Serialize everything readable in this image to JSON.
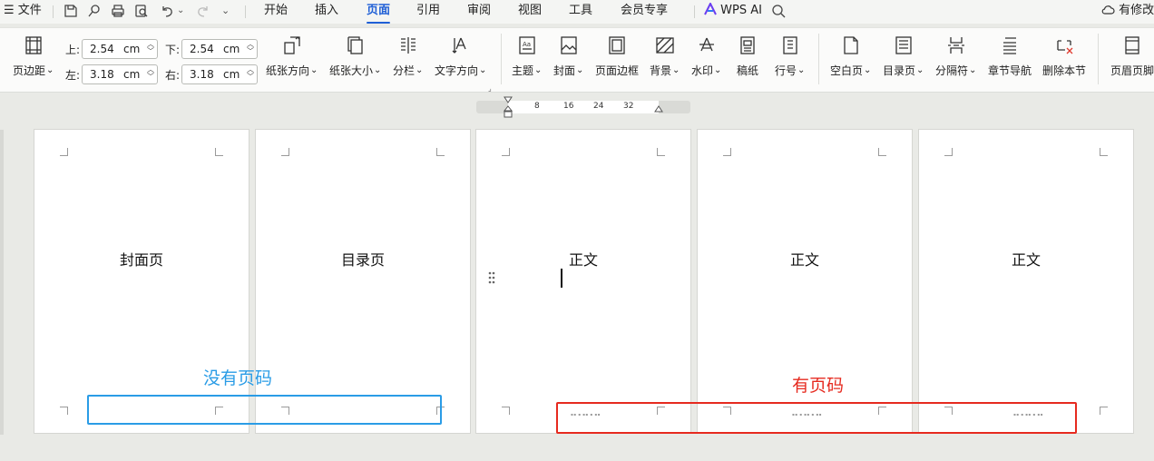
{
  "menubar": {
    "file_label": "文件",
    "tabs": [
      {
        "label": "开始"
      },
      {
        "label": "插入"
      },
      {
        "label": "页面"
      },
      {
        "label": "引用"
      },
      {
        "label": "审阅"
      },
      {
        "label": "视图"
      },
      {
        "label": "工具"
      },
      {
        "label": "会员专享"
      }
    ],
    "active_tab": "页面",
    "wps_ai_label": "WPS AI",
    "right_label": "有修改"
  },
  "ribbon": {
    "margins_label": "页边距",
    "margins": {
      "top_label": "上:",
      "top_value": "2.54",
      "top_unit": "cm",
      "bottom_label": "下:",
      "bottom_value": "2.54",
      "bottom_unit": "cm",
      "left_label": "左:",
      "left_value": "3.18",
      "left_unit": "cm",
      "right_label": "右:",
      "right_value": "3.18",
      "right_unit": "cm"
    },
    "orientation_label": "纸张方向",
    "size_label": "纸张大小",
    "columns_label": "分栏",
    "text_direction_label": "文字方向",
    "theme_label": "主题",
    "cover_label": "封面",
    "page_border_label": "页面边框",
    "background_label": "背景",
    "watermark_label": "水印",
    "manuscript_label": "稿纸",
    "line_number_label": "行号",
    "blank_page_label": "空白页",
    "toc_page_label": "目录页",
    "break_label": "分隔符",
    "section_nav_label": "章节导航",
    "delete_section_label": "删除本节",
    "header_footer_label": "页眉页脚"
  },
  "ruler": {
    "ticks": [
      "8",
      "16",
      "24",
      "32"
    ]
  },
  "pages": [
    {
      "title": "封面页"
    },
    {
      "title": "目录页"
    },
    {
      "title": "正文"
    },
    {
      "title": "正文"
    },
    {
      "title": "正文"
    }
  ],
  "annotations": {
    "no_page_number": "没有页码",
    "has_page_number": "有页码",
    "blue": "#2a9ce6",
    "red": "#e62a1f"
  },
  "colors": {
    "accent": "#1f5fd6"
  }
}
